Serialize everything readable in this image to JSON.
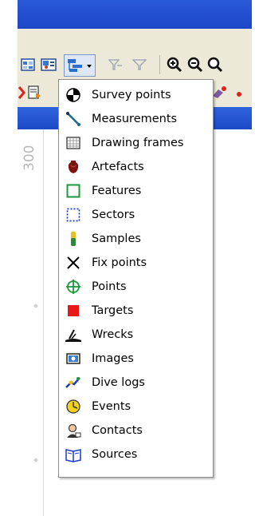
{
  "colors": {
    "titlebar": "#1c47c7",
    "toolbar_bg": "#ece9d8",
    "menu_bg": "#ffffff",
    "menu_border": "#8d8d8d"
  },
  "ruler": {
    "label": "300"
  },
  "toolbar": {
    "icons": [
      "table-icon",
      "map-layer-icon",
      "layer-tree-dropdown-icon",
      "filter-icon",
      "filter-funnel-icon",
      "zoom-in-icon",
      "zoom-out-icon",
      "zoom-icon"
    ]
  },
  "menu": {
    "items": [
      {
        "label": "Survey points",
        "icon": "survey-point-icon"
      },
      {
        "label": "Measurements",
        "icon": "measurement-icon"
      },
      {
        "label": "Drawing frames",
        "icon": "drawing-frame-icon"
      },
      {
        "label": "Artefacts",
        "icon": "artefact-icon"
      },
      {
        "label": "Features",
        "icon": "feature-icon"
      },
      {
        "label": "Sectors",
        "icon": "sector-icon"
      },
      {
        "label": "Samples",
        "icon": "sample-icon"
      },
      {
        "label": "Fix points",
        "icon": "fix-point-icon"
      },
      {
        "label": "Points",
        "icon": "point-icon"
      },
      {
        "label": "Targets",
        "icon": "target-icon"
      },
      {
        "label": "Wrecks",
        "icon": "wreck-icon"
      },
      {
        "label": "Images",
        "icon": "image-icon"
      },
      {
        "label": "Dive logs",
        "icon": "dive-log-icon"
      },
      {
        "label": "Events",
        "icon": "event-icon"
      },
      {
        "label": "Contacts",
        "icon": "contact-icon"
      },
      {
        "label": "Sources",
        "icon": "source-icon"
      }
    ]
  }
}
